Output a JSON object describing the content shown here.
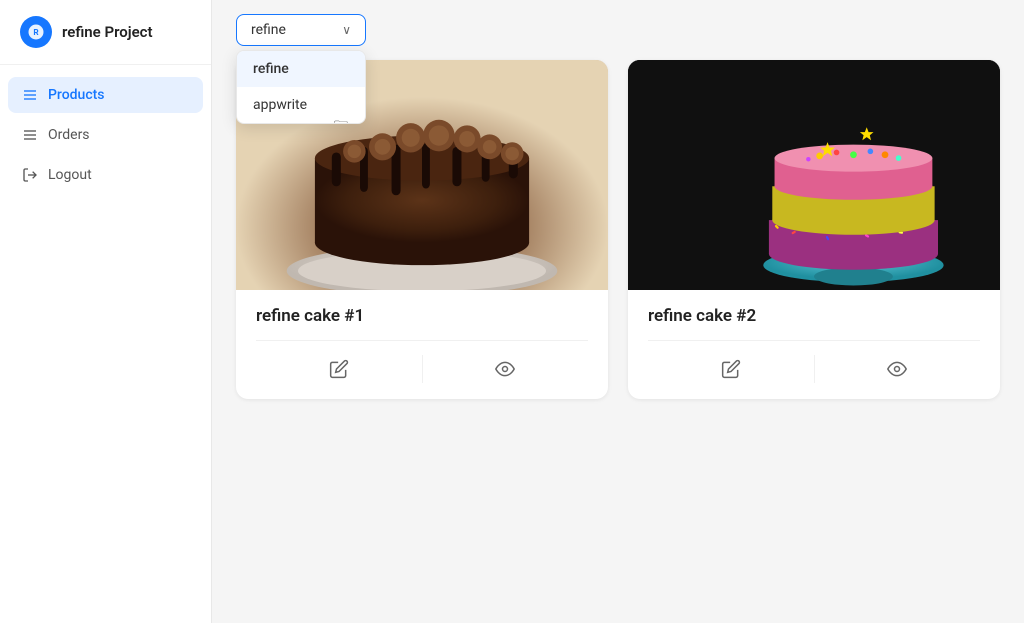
{
  "app": {
    "logo_text": "refine Project",
    "logo_initial": "R"
  },
  "sidebar": {
    "items": [
      {
        "id": "products",
        "label": "Products",
        "icon": "list",
        "active": true
      },
      {
        "id": "orders",
        "label": "Orders",
        "icon": "list",
        "active": false
      },
      {
        "id": "logout",
        "label": "Logout",
        "icon": "logout",
        "active": false
      }
    ]
  },
  "dropdown": {
    "selected": "refine",
    "chevron": "∨",
    "options": [
      {
        "id": "refine",
        "label": "refine"
      },
      {
        "id": "appwrite",
        "label": "appwrite"
      }
    ]
  },
  "products": [
    {
      "id": "cake1",
      "name": "refine cake #1",
      "edit_label": "Edit",
      "show_label": "Show"
    },
    {
      "id": "cake2",
      "name": "refine cake #2",
      "edit_label": "Edit",
      "show_label": "Show"
    }
  ],
  "icons": {
    "edit": "pencil",
    "show": "eye",
    "list": "≡",
    "logout": "exit"
  }
}
